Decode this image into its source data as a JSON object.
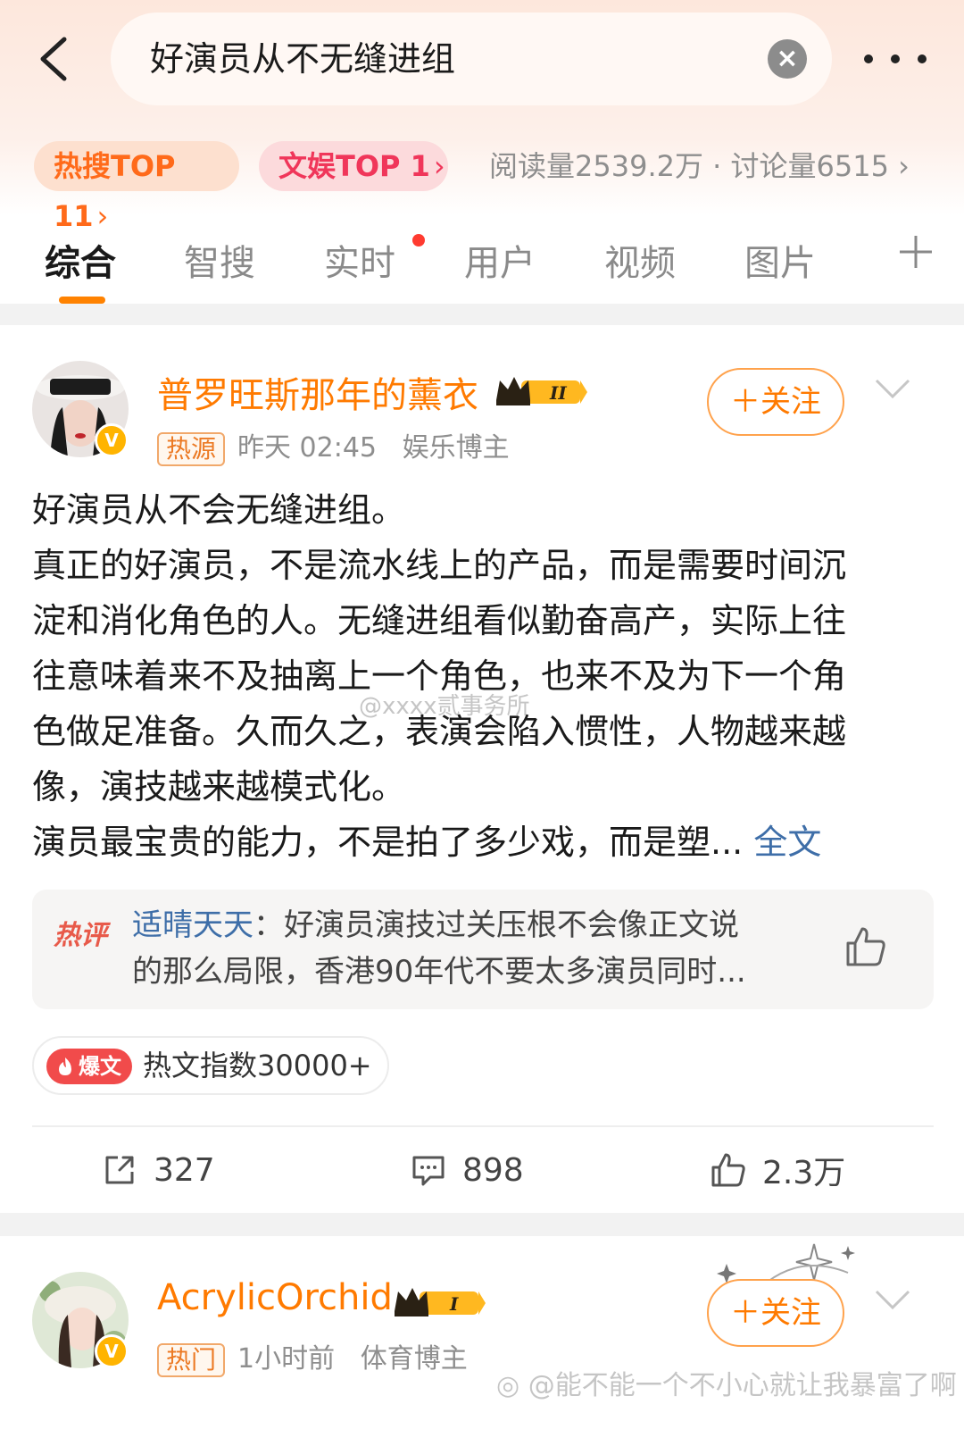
{
  "header": {
    "search_query": "好演员从不无缝进组",
    "clear_icon": "close-icon",
    "more_icon": "more-icon"
  },
  "topic_bar": {
    "hot_search_label": "热搜TOP 11",
    "entertainment_label": "文娱TOP 1",
    "arrow": "›",
    "stats": "阅读量2539.2万 · 讨论量6515 ›"
  },
  "tabs": [
    {
      "label": "综合",
      "active": true
    },
    {
      "label": "智搜"
    },
    {
      "label": "实时",
      "has_dot": true
    },
    {
      "label": "用户"
    },
    {
      "label": "视频"
    },
    {
      "label": "图片"
    }
  ],
  "post1": {
    "username": "普罗旺斯那年的薰衣",
    "level_badge": "II",
    "source_tag": "热源",
    "time": "昨天 02:45",
    "category": "娱乐博主",
    "follow_label": "＋关注",
    "verified_badge": "V",
    "content_lines": [
      "好演员从不会无缝进组。",
      "真正的好演员，不是流水线上的产品，而是需要时间沉",
      "淀和消化角色的人。无缝进组看似勤奋高产，实际上往",
      "往意味着来不及抽离上一个角色，也来不及为下一个角",
      "色做足准备。久而久之，表演会陷入惯性，人物越来越",
      "像，演技越来越模式化。",
      "演员最宝贵的能力，不是拍了多少戏，而是塑..."
    ],
    "full_text_link": "全文",
    "watermark": "@xxxx贰事务所",
    "hot_comment": {
      "label": "热评",
      "user": "适晴天天",
      "separator": "：",
      "text_line1": "好演员演技过关压根不会像正文说",
      "text_line2": "的那么局限，香港90年代不要太多演员同时..."
    },
    "hot_index": {
      "tag": "爆文",
      "text": "热文指数30000+"
    },
    "actions": {
      "reposts": "327",
      "comments": "898",
      "likes": "2.3万"
    }
  },
  "post2": {
    "username": "AcrylicOrchid",
    "level_badge": "I",
    "source_tag": "热门",
    "time": "1小时前",
    "category": "体育博主",
    "follow_label": "＋关注",
    "verified_badge": "V"
  },
  "footer_watermark": "@能不能一个不小心就让我暴富了啊",
  "colors": {
    "accent_orange": "#ff7a00",
    "hot_red": "#f14b4b",
    "link_blue": "#3e6ea8"
  }
}
